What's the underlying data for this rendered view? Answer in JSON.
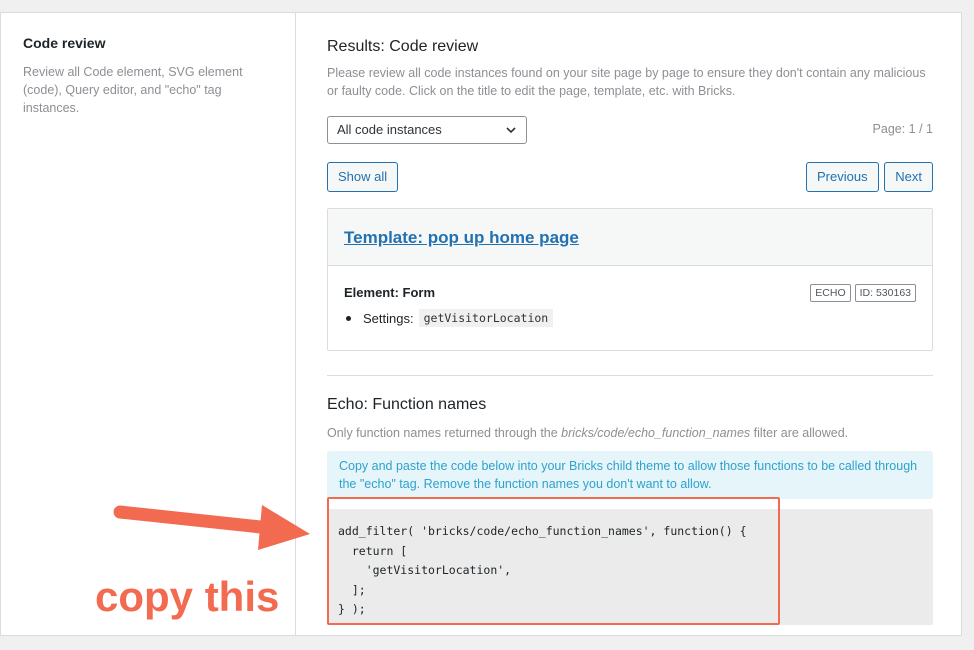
{
  "sidebar": {
    "title": "Code review",
    "description": "Review all Code element, SVG element (code), Query editor, and \"echo\" tag instances."
  },
  "results": {
    "title": "Results: Code review",
    "description": "Please review all code instances found on your site page by page to ensure they don't contain any malicious or faulty code. Click on the title to edit the page, template, etc. with Bricks.",
    "select_value": "All code instances",
    "page_label": "Page: 1 / 1",
    "show_all": "Show all",
    "previous": "Previous",
    "next": "Next"
  },
  "card": {
    "link": "Template: pop up home page",
    "element_title": "Element: Form",
    "badge_echo": "ECHO",
    "badge_id": "ID: 530163",
    "settings_label": "Settings:",
    "settings_value": "getVisitorLocation"
  },
  "echo": {
    "title": "Echo: Function names",
    "desc_before": "Only function names returned through the ",
    "desc_filter": "bricks/code/echo_function_names",
    "desc_after": " filter are allowed.",
    "info": "Copy and paste the code below into your Bricks child theme to allow those functions to be called through the \"echo\" tag. Remove the function names you don't want to allow.",
    "code": "add_filter( 'bricks/code/echo_function_names', function() {\n  return [\n    'getVisitorLocation',\n  ];\n} );"
  },
  "annotation": {
    "text": "copy this",
    "color": "#f26a4f"
  }
}
